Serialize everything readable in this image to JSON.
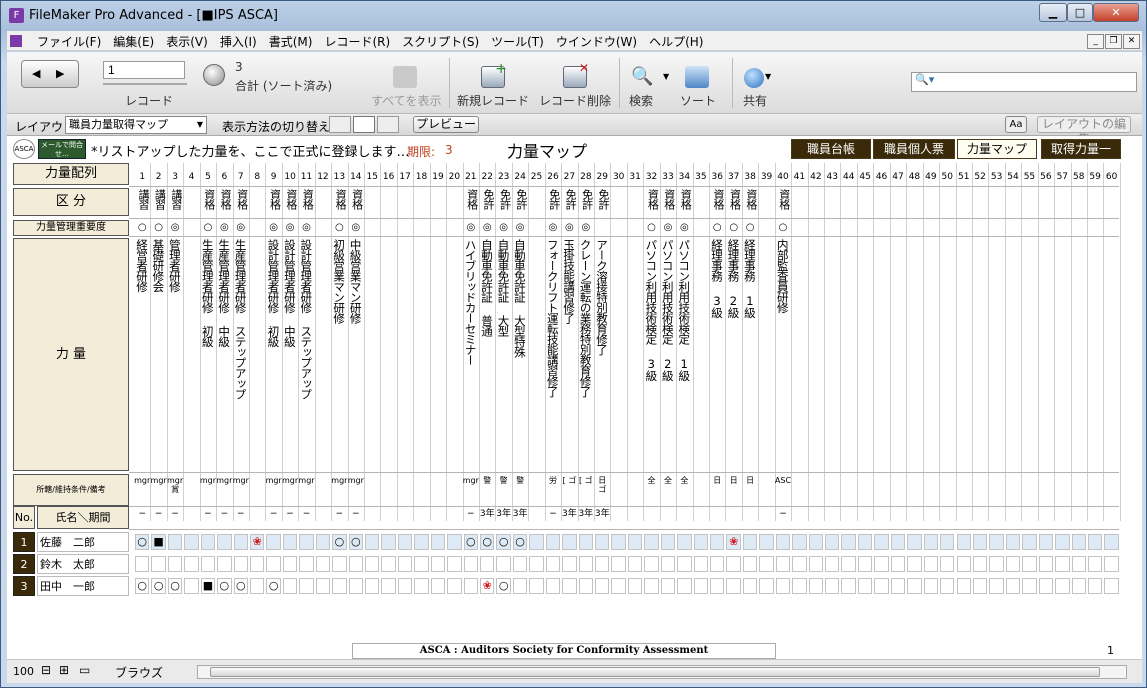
{
  "window": {
    "title": "FileMaker Pro Advanced - [■IPS ASCA]",
    "minimize": "▁",
    "maximize": "□",
    "close": "✕"
  },
  "menu": [
    "ファイル(F)",
    "編集(E)",
    "表示(V)",
    "挿入(I)",
    "書式(M)",
    "レコード(R)",
    "スクリプト(S)",
    "ツール(T)",
    "ウインドウ(W)",
    "ヘルプ(H)"
  ],
  "toolbar": {
    "record_value": "1",
    "record_label": "レコード",
    "found_count": "3",
    "found_label": "合計 (ソート済み)",
    "show_all": "すべてを表示",
    "new_record": "新規レコード",
    "delete_record": "レコード削除",
    "find": "検索",
    "sort": "ソート",
    "share": "共有",
    "search_placeholder": ""
  },
  "layoutbar": {
    "layout_label": "レイアウト:",
    "layout_value": "職員力量取得マップ",
    "view_label": "表示方法の切り替え:",
    "preview": "プレビュー",
    "aa": "Aa",
    "edit_layout": "レイアウトの編集"
  },
  "header": {
    "mail_btn": "メールで問合せ…",
    "notice": "*リストアップした力量を、ここで正式に登録します…",
    "deadline_label": "期限:",
    "deadline_value": "3",
    "map_title": "力量マップ",
    "logo": "ASCA"
  },
  "nav": [
    "職員台帳",
    "職員個人票",
    "力量マップ",
    "取得力量一覧"
  ],
  "row_labels": {
    "sequence": "力量配列",
    "category": "区 分",
    "importance": "力量管理重要度",
    "competence": "力 量",
    "requirement": "所轄/維持条件/備考",
    "no": "No.",
    "name": "氏名",
    "period": "期間"
  },
  "columns": [
    {
      "n": "1",
      "cat": "講習",
      "imp": "○",
      "name": "経営者研修",
      "req": "mgr",
      "per": "−"
    },
    {
      "n": "2",
      "cat": "講習",
      "imp": "○",
      "name": "基礎研修会",
      "req": "mgr",
      "per": "−"
    },
    {
      "n": "3",
      "cat": "講習",
      "imp": "◎",
      "name": "管理者研修",
      "req": "mgr 賞",
      "per": "−"
    },
    {
      "n": "4",
      "cat": "",
      "imp": "",
      "name": "",
      "req": "",
      "per": ""
    },
    {
      "n": "5",
      "cat": "資格",
      "imp": "○",
      "name": "生産管理者研修 初級",
      "req": "mgr",
      "per": "−"
    },
    {
      "n": "6",
      "cat": "資格",
      "imp": "◎",
      "name": "生産管理者研修 中級",
      "req": "mgr",
      "per": "−"
    },
    {
      "n": "7",
      "cat": "資格",
      "imp": "◎",
      "name": "生産管理者研修 ステップアップ",
      "req": "mgr",
      "per": "−"
    },
    {
      "n": "8",
      "cat": "",
      "imp": "",
      "name": "",
      "req": "",
      "per": ""
    },
    {
      "n": "9",
      "cat": "資格",
      "imp": "◎",
      "name": "設計管理者研修 初級",
      "req": "mgr",
      "per": "−"
    },
    {
      "n": "10",
      "cat": "資格",
      "imp": "◎",
      "name": "設計管理者研修 中級",
      "req": "mgr",
      "per": "−"
    },
    {
      "n": "11",
      "cat": "資格",
      "imp": "◎",
      "name": "設計管理者研修 ステップアップ",
      "req": "mgr",
      "per": "−"
    },
    {
      "n": "12",
      "cat": "",
      "imp": "",
      "name": "",
      "req": "",
      "per": ""
    },
    {
      "n": "13",
      "cat": "資格",
      "imp": "○",
      "name": "初級営業マン研修",
      "req": "mgr",
      "per": "−"
    },
    {
      "n": "14",
      "cat": "資格",
      "imp": "◎",
      "name": "中級営業マン研修",
      "req": "mgr",
      "per": "−"
    },
    {
      "n": "15",
      "cat": "",
      "imp": "",
      "name": "",
      "req": "",
      "per": ""
    },
    {
      "n": "16",
      "cat": "",
      "imp": "",
      "name": "",
      "req": "",
      "per": ""
    },
    {
      "n": "17",
      "cat": "",
      "imp": "",
      "name": "",
      "req": "",
      "per": ""
    },
    {
      "n": "18",
      "cat": "",
      "imp": "",
      "name": "",
      "req": "",
      "per": ""
    },
    {
      "n": "19",
      "cat": "",
      "imp": "",
      "name": "",
      "req": "",
      "per": ""
    },
    {
      "n": "20",
      "cat": "",
      "imp": "",
      "name": "",
      "req": "",
      "per": ""
    },
    {
      "n": "21",
      "cat": "資格",
      "imp": "◎",
      "name": "ハイブリッドカーセミナー",
      "req": "mgr",
      "per": "−"
    },
    {
      "n": "22",
      "cat": "免許",
      "imp": "◎",
      "name": "自動車免許証 普通",
      "req": "警",
      "per": "3年"
    },
    {
      "n": "23",
      "cat": "免許",
      "imp": "◎",
      "name": "自動車免許証 大型",
      "req": "警",
      "per": "3年"
    },
    {
      "n": "24",
      "cat": "免許",
      "imp": "◎",
      "name": "自動車免許証 大型特殊",
      "req": "警",
      "per": "3年"
    },
    {
      "n": "25",
      "cat": "",
      "imp": "",
      "name": "",
      "req": "",
      "per": ""
    },
    {
      "n": "26",
      "cat": "免許",
      "imp": "◎",
      "name": "フォークリフト運転技能講習修了",
      "req": "労",
      "per": "−"
    },
    {
      "n": "27",
      "cat": "免許",
      "imp": "◎",
      "name": "玉掛技能講習修了",
      "req": "[ ゴ",
      "per": "3年"
    },
    {
      "n": "28",
      "cat": "免許",
      "imp": "◎",
      "name": "クレーン運転の業務特別教育修了",
      "req": "[ ゴ",
      "per": "3年"
    },
    {
      "n": "29",
      "cat": "免許",
      "imp": "",
      "name": "アーク溶接特別教育修了",
      "req": "日 ゴ",
      "per": "3年"
    },
    {
      "n": "30",
      "cat": "",
      "imp": "",
      "name": "",
      "req": "",
      "per": ""
    },
    {
      "n": "31",
      "cat": "",
      "imp": "",
      "name": "",
      "req": "",
      "per": ""
    },
    {
      "n": "32",
      "cat": "資格",
      "imp": "○",
      "name": "パソコン利用技術検定 3級",
      "req": "全",
      "per": ""
    },
    {
      "n": "33",
      "cat": "資格",
      "imp": "◎",
      "name": "パソコン利用技術検定 2級",
      "req": "全",
      "per": ""
    },
    {
      "n": "34",
      "cat": "資格",
      "imp": "◎",
      "name": "パソコン利用技術検定 1級",
      "req": "全",
      "per": ""
    },
    {
      "n": "35",
      "cat": "",
      "imp": "",
      "name": "",
      "req": "",
      "per": ""
    },
    {
      "n": "36",
      "cat": "資格",
      "imp": "○",
      "name": "経理事務 3級",
      "req": "日",
      "per": ""
    },
    {
      "n": "37",
      "cat": "資格",
      "imp": "○",
      "name": "経理事務 2級",
      "req": "日",
      "per": ""
    },
    {
      "n": "38",
      "cat": "資格",
      "imp": "○",
      "name": "経理事務 1級",
      "req": "日",
      "per": ""
    },
    {
      "n": "39",
      "cat": "",
      "imp": "",
      "name": "",
      "req": "",
      "per": ""
    },
    {
      "n": "40",
      "cat": "資格",
      "imp": "○",
      "name": "内部監査員研修",
      "req": "ASC",
      "per": "−"
    }
  ],
  "extra_columns": [
    "41",
    "42",
    "43",
    "44",
    "45",
    "46",
    "47",
    "48",
    "49",
    "50",
    "51",
    "52",
    "53",
    "54",
    "55",
    "56",
    "57",
    "58",
    "59",
    "60"
  ],
  "staff": [
    {
      "no": "1",
      "name": "佐藤　二郎",
      "marks": {
        "1": "○",
        "2": "■",
        "8": "❀",
        "13": "○",
        "14": "○",
        "21": "○",
        "22": "○",
        "23": "○",
        "24": "○",
        "37": "❀"
      }
    },
    {
      "no": "2",
      "name": "鈴木　太郎",
      "marks": {}
    },
    {
      "no": "3",
      "name": "田中　一郎",
      "marks": {
        "1": "○",
        "2": "○",
        "3": "○",
        "5": "■",
        "6": "○",
        "7": "○",
        "9": "○",
        "22": "❀",
        "23": "○"
      }
    }
  ],
  "footer": {
    "banner": "ASCA : Auditors Society for Conformity Assessment",
    "page": "1"
  },
  "status": {
    "zoom": "100",
    "mode": "ブラウズ"
  }
}
